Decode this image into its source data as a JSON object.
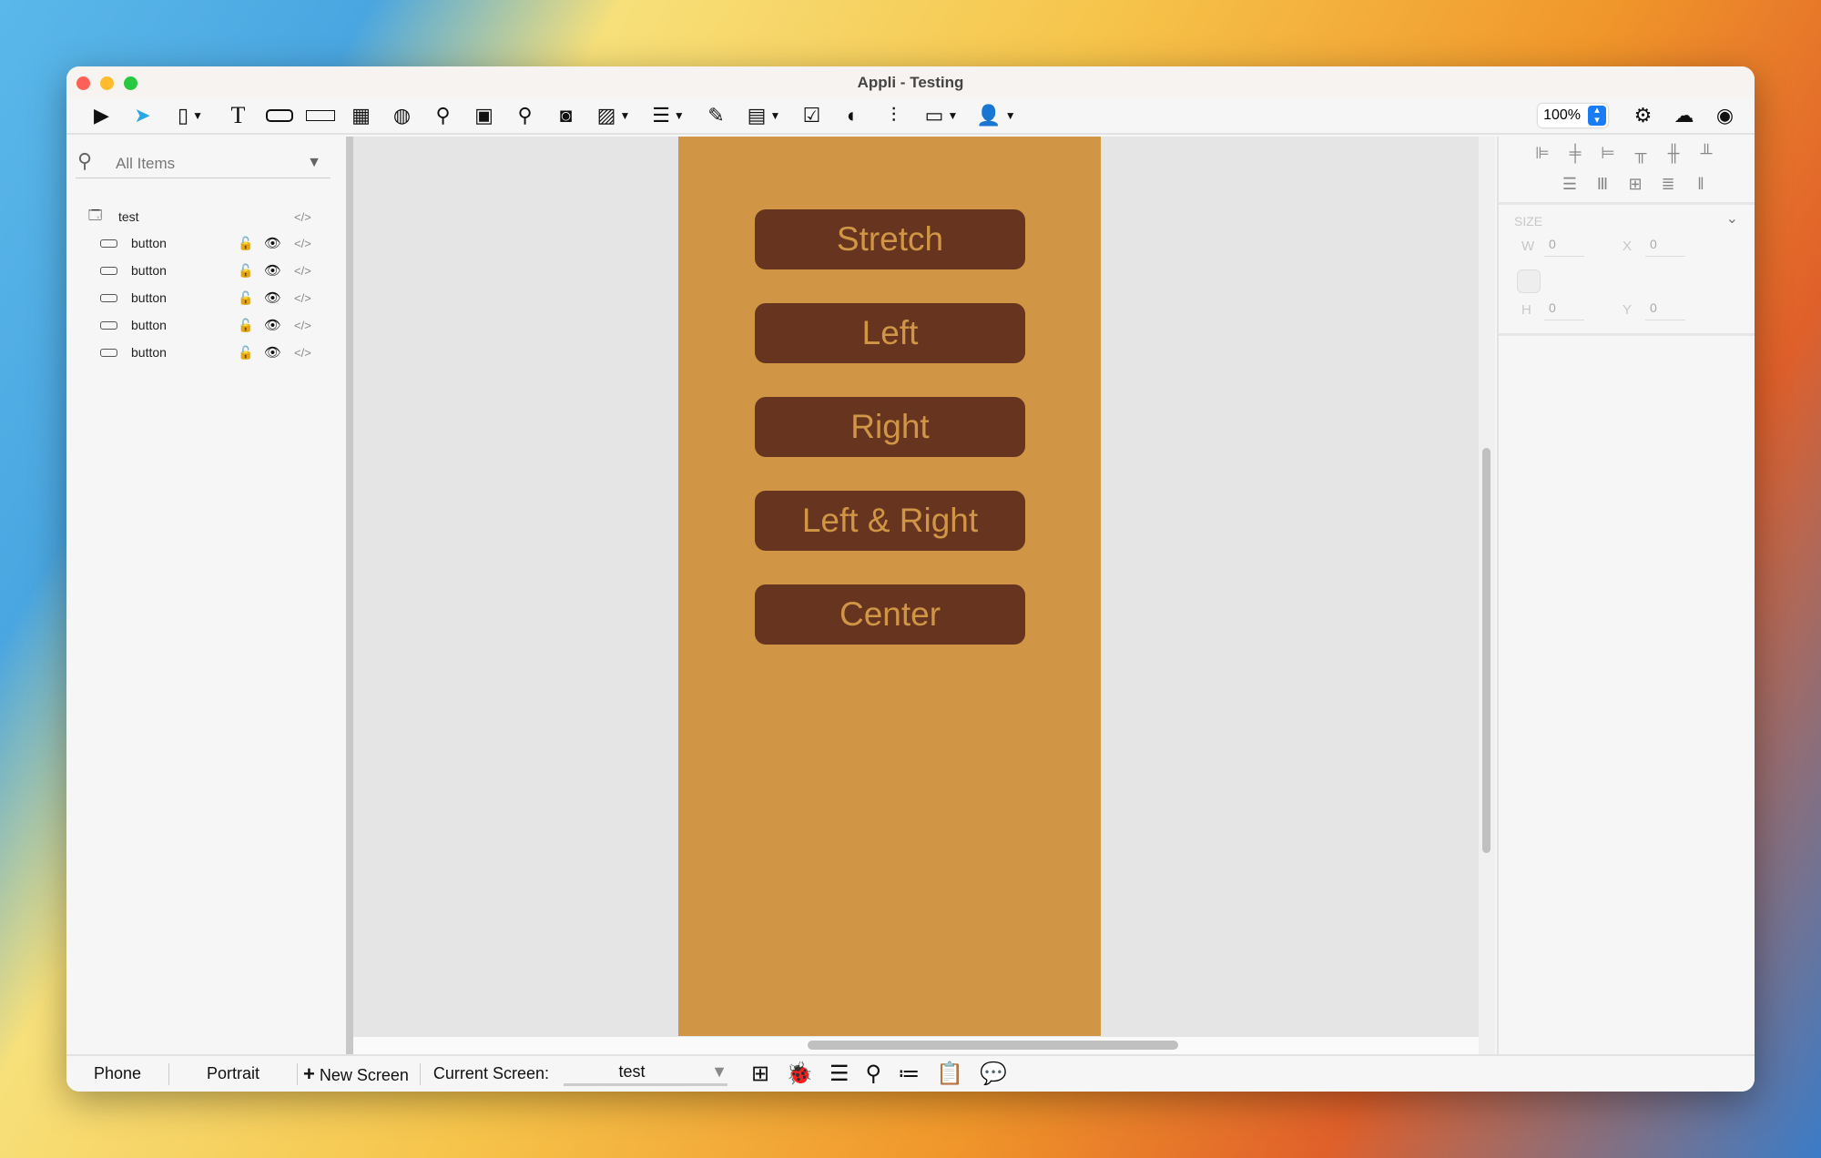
{
  "window": {
    "title": "Appli - Testing"
  },
  "toolbar": {
    "icons": [
      "play-icon",
      "pointer-icon",
      "rectangle-icon",
      "text-icon",
      "button-icon",
      "textfield-icon",
      "table-icon",
      "globe-icon",
      "map-pin-icon",
      "chart-icon",
      "search-icon",
      "camera-icon",
      "image-icon",
      "list-icon",
      "edit-icon",
      "form-icon",
      "checkbox-icon",
      "toggle-icon",
      "sliders-icon",
      "calendar-icon",
      "add-user-icon"
    ],
    "zoom": "100%"
  },
  "sidebar": {
    "search_placeholder": "All Items",
    "root": "test",
    "items": [
      {
        "label": "button"
      },
      {
        "label": "button"
      },
      {
        "label": "button"
      },
      {
        "label": "button"
      },
      {
        "label": "button"
      }
    ]
  },
  "canvas": {
    "phone_color": "#D09545",
    "button_color": "#67351F",
    "buttons": [
      {
        "label": "Stretch"
      },
      {
        "label": "Left"
      },
      {
        "label": "Right"
      },
      {
        "label": "Left & Right"
      },
      {
        "label": "Center"
      }
    ]
  },
  "inspector": {
    "section": "SIZE",
    "w_label": "W",
    "h_label": "H",
    "x_label": "X",
    "y_label": "Y",
    "w": "0",
    "h": "0",
    "x": "0",
    "y": "0"
  },
  "bottombar": {
    "device": "Phone",
    "orientation": "Portrait",
    "new_screen": "New Screen",
    "current_screen_label": "Current Screen:",
    "current_screen": "test"
  }
}
